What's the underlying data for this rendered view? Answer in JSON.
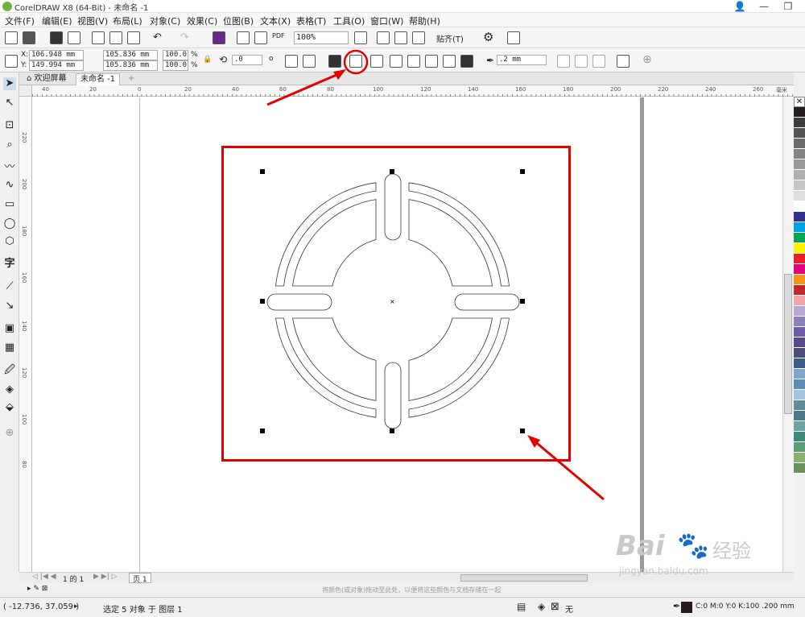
{
  "window": {
    "title": "CorelDRAW X8 (64-Bit) - 未命名 -1"
  },
  "menu": [
    "文件(F)",
    "编辑(E)",
    "视图(V)",
    "布局(L)",
    "对象(C)",
    "效果(C)",
    "位图(B)",
    "文本(X)",
    "表格(T)",
    "工具(O)",
    "窗口(W)",
    "帮助(H)"
  ],
  "toolbar": {
    "zoom": "100%",
    "snap_label": "贴齐(T)",
    "pdf_label": "PDF"
  },
  "props": {
    "x_label": "X:",
    "x": "106.948 mm",
    "y_label": "Y:",
    "y": "149.994 mm",
    "w": "105.836 mm",
    "h": "105.836 mm",
    "sx": "100.0",
    "sy": "100.0",
    "pct": "%",
    "rotation": ".0",
    "degree": "o",
    "outline": ".2 mm"
  },
  "tabs": {
    "welcome": "欢迎屏幕",
    "doc": "未命名 -1",
    "add": "+"
  },
  "ruler": {
    "h": [
      "40",
      "20",
      "0",
      "20",
      "40",
      "60",
      "80",
      "100",
      "120",
      "140",
      "160",
      "180",
      "200",
      "220",
      "240",
      "260"
    ],
    "h_unit": "毫米",
    "v": [
      "220",
      "200",
      "180",
      "160",
      "140",
      "120",
      "100",
      "80"
    ]
  },
  "pagenav": {
    "counter": "1 的 1",
    "page_tab": "页 1"
  },
  "hint": "将颜色(或对象)拖动至此处，以便将这些颜色与文档存储在一起",
  "status": {
    "coords": "( -12.736, 37.059 )",
    "selection": "选定 5 对象 于 图层 1",
    "fill": "无",
    "color_info": "C:0 M:0 Y:0 K:100 .200 mm"
  },
  "colors": {
    "annotation": "#e30000"
  },
  "palette": [
    "#231f20",
    "#3d3d3d",
    "#545454",
    "#6b6b6b",
    "#828282",
    "#999999",
    "#b0b0b0",
    "#c7c7c7",
    "#dedede",
    "#ffffff",
    "#2e3192",
    "#00a0e9",
    "#00a651",
    "#fff200",
    "#ed1c24",
    "#e4007f",
    "#f7941d",
    "#c1272d",
    "#f5a3a8",
    "#b7a8d4",
    "#8781bd",
    "#6d5fa5",
    "#5b4a8b",
    "#4d4d7a",
    "#3e5c8a",
    "#7fa7c9",
    "#5b8fb9",
    "#a3c4dc",
    "#5f8b9b",
    "#4a7a88",
    "#6ba5a0",
    "#3f8a78",
    "#5c9d7a",
    "#8ab06f",
    "#6f8f5d"
  ],
  "watermark": {
    "main": "Bai",
    "sub": "jingyan.baidu.com",
    "cn": "经验"
  }
}
